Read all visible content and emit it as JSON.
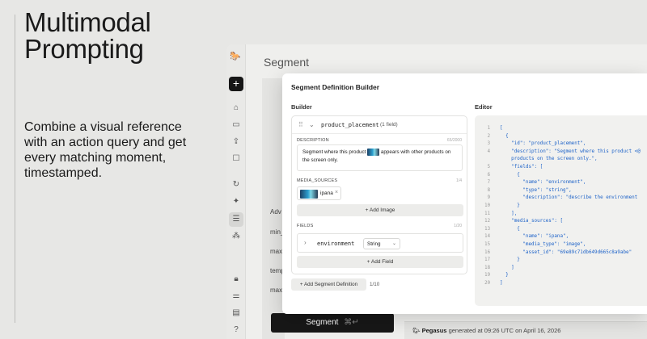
{
  "hero": {
    "title": "Multimodal\nPrompting",
    "description": "Combine a visual reference with an action query and get every matching moment, timestamped."
  },
  "background_app": {
    "page_title": "Segment",
    "segment_button": "Segment",
    "segment_shortcut": "⌘↵",
    "generated_brand": "Pegasus",
    "generated_text": "generated at 09:26 UTC on April 16, 2026",
    "labels": [
      "Adv",
      "min_",
      "max_",
      "temp",
      "max_"
    ]
  },
  "modal": {
    "title": "Segment Definition Builder",
    "builder_label": "Builder",
    "editor_label": "Editor",
    "segment": {
      "name": "product_placement",
      "field_count": "(1 field)",
      "description_label": "DESCRIPTION",
      "description_count": "65/2000",
      "description_before": "Segment where this product",
      "description_after": "appears with other products on the screen only.",
      "media_label": "MEDIA_SOURCES",
      "media_count": "1/4",
      "media_chip": "ipana",
      "add_image": "+  Add Image",
      "fields_label": "FIELDS",
      "fields_count": "1/20",
      "field_name": "environment",
      "field_type": "String",
      "add_field": "+  Add Field"
    },
    "add_definition": "+  Add Segment Definition",
    "pager": "1/10"
  },
  "editor": {
    "lines": [
      {
        "n": "1",
        "t": "["
      },
      {
        "n": "2",
        "t": "  {"
      },
      {
        "n": "3",
        "t": "    \"id\": \"product_placement\","
      },
      {
        "n": "4",
        "t": "    \"description\": \"Segment where this product <@"
      },
      {
        "n": "",
        "t": "    products on the screen only.\","
      },
      {
        "n": "5",
        "t": "    \"fields\": ["
      },
      {
        "n": "6",
        "t": "      {"
      },
      {
        "n": "7",
        "t": "        \"name\": \"environment\","
      },
      {
        "n": "8",
        "t": "        \"type\": \"string\","
      },
      {
        "n": "9",
        "t": "        \"description\": \"describe the environment"
      },
      {
        "n": "10",
        "t": "      }"
      },
      {
        "n": "11",
        "t": "    ],"
      },
      {
        "n": "12",
        "t": "    \"media_sources\": ["
      },
      {
        "n": "13",
        "t": "      {"
      },
      {
        "n": "14",
        "t": "        \"name\": \"ipana\","
      },
      {
        "n": "15",
        "t": "        \"media_type\": \"image\","
      },
      {
        "n": "16",
        "t": "        \"asset_id\": \"69e89c71db649d665c8a9abe\""
      },
      {
        "n": "17",
        "t": "      }"
      },
      {
        "n": "18",
        "t": "    ]"
      },
      {
        "n": "19",
        "t": "  }"
      },
      {
        "n": "20",
        "t": "]"
      }
    ]
  },
  "colors": {
    "accent_dark": "#161616",
    "json_key": "#1e63c8",
    "page_bg": "#e7e7e5"
  }
}
